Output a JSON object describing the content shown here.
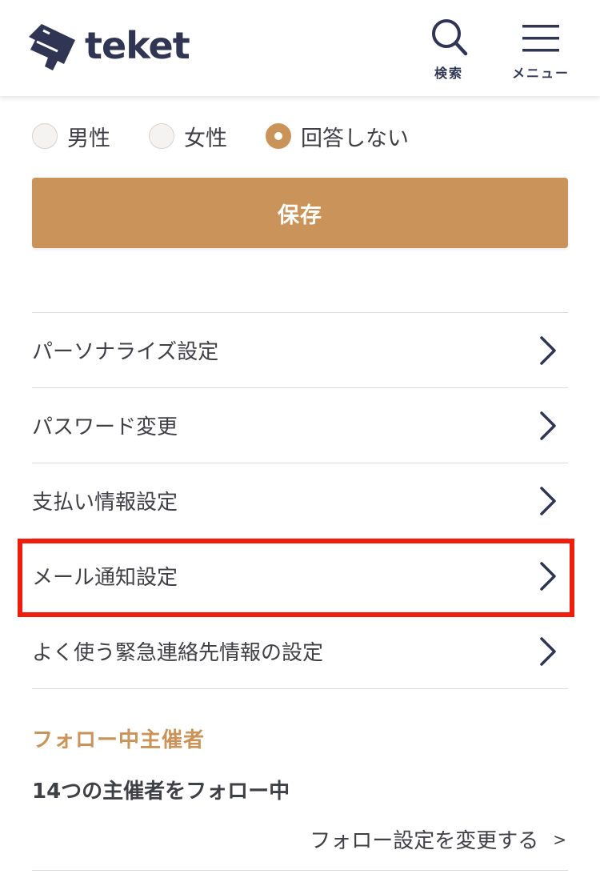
{
  "header": {
    "logo_text": "teket",
    "search_label": "検索",
    "menu_label": "メニュー"
  },
  "gender": {
    "options": [
      {
        "label": "男性",
        "checked": false
      },
      {
        "label": "女性",
        "checked": false
      },
      {
        "label": "回答しない",
        "checked": true
      }
    ]
  },
  "save_button": {
    "label": "保存"
  },
  "settings": {
    "items": [
      {
        "label": "パーソナライズ設定"
      },
      {
        "label": "パスワード変更"
      },
      {
        "label": "支払い情報設定"
      },
      {
        "label": "メール通知設定"
      },
      {
        "label": "よく使う緊急連絡先情報の設定"
      }
    ]
  },
  "follow": {
    "section_title": "フォロー中主催者",
    "count_text": "14つの主催者をフォロー中",
    "change_link": "フォロー設定を変更する",
    "change_arrow": ">"
  },
  "colors": {
    "accent": "#c9935a",
    "navy": "#2f3552",
    "highlight": "#f01c0c"
  }
}
